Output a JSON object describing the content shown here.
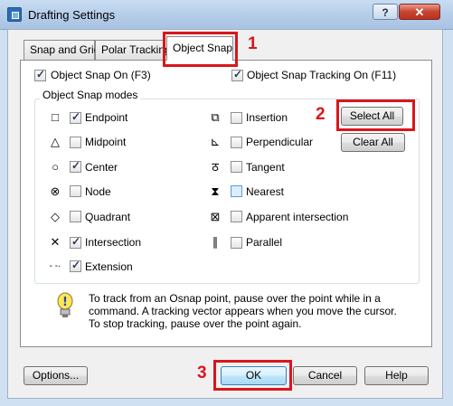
{
  "window": {
    "title": "Drafting Settings",
    "help_label": "?",
    "close_label": "✕"
  },
  "tabs": [
    {
      "label": "Snap and Grid"
    },
    {
      "label": "Polar Tracking"
    },
    {
      "label": "Object Snap"
    }
  ],
  "options": {
    "osnap_on": {
      "label": "Object Snap On (F3)",
      "checked": true
    },
    "osnap_tracking": {
      "label": "Object Snap Tracking On (F11)",
      "checked": true
    }
  },
  "modes_group": {
    "title": "Object Snap modes"
  },
  "modes_left": [
    {
      "label": "Endpoint",
      "checked": true,
      "icon": "square-marker-icon",
      "glyph": "□"
    },
    {
      "label": "Midpoint",
      "checked": false,
      "icon": "triangle-marker-icon",
      "glyph": "△"
    },
    {
      "label": "Center",
      "checked": true,
      "icon": "circle-marker-icon",
      "glyph": "○"
    },
    {
      "label": "Node",
      "checked": false,
      "icon": "node-marker-icon",
      "glyph": "⊗"
    },
    {
      "label": "Quadrant",
      "checked": false,
      "icon": "diamond-marker-icon",
      "glyph": "◇"
    },
    {
      "label": "Intersection",
      "checked": true,
      "icon": "x-marker-icon",
      "glyph": "✕"
    },
    {
      "label": "Extension",
      "checked": true,
      "icon": "extension-marker-icon",
      "glyph": "- -·"
    }
  ],
  "modes_right": [
    {
      "label": "Insertion",
      "checked": false,
      "icon": "insertion-marker-icon",
      "glyph": "⧉"
    },
    {
      "label": "Perpendicular",
      "checked": false,
      "icon": "perpendicular-marker-icon",
      "glyph": "⊾"
    },
    {
      "label": "Tangent",
      "checked": false,
      "icon": "tangent-marker-icon",
      "glyph": "ठ"
    },
    {
      "label": "Nearest",
      "checked": false,
      "icon": "nearest-marker-icon",
      "glyph": "⧗"
    },
    {
      "label": "Apparent intersection",
      "checked": false,
      "icon": "apparent-intersection-marker-icon",
      "glyph": "⊠"
    },
    {
      "label": "Parallel",
      "checked": false,
      "icon": "parallel-marker-icon",
      "glyph": "∥"
    }
  ],
  "buttons": {
    "select_all": "Select All",
    "clear_all": "Clear All",
    "options": "Options...",
    "ok": "OK",
    "cancel": "Cancel",
    "help": "Help"
  },
  "info": {
    "lines": [
      "To track from an Osnap point, pause over the point while in a",
      "command.  A tracking vector appears when you move the cursor.",
      "To stop tracking, pause over the point again."
    ]
  },
  "annotations": {
    "n1": "1",
    "n2": "2",
    "n3": "3"
  },
  "colors": {
    "annotation_red": "#d9161c",
    "title_bar": "#b3cbe8"
  }
}
